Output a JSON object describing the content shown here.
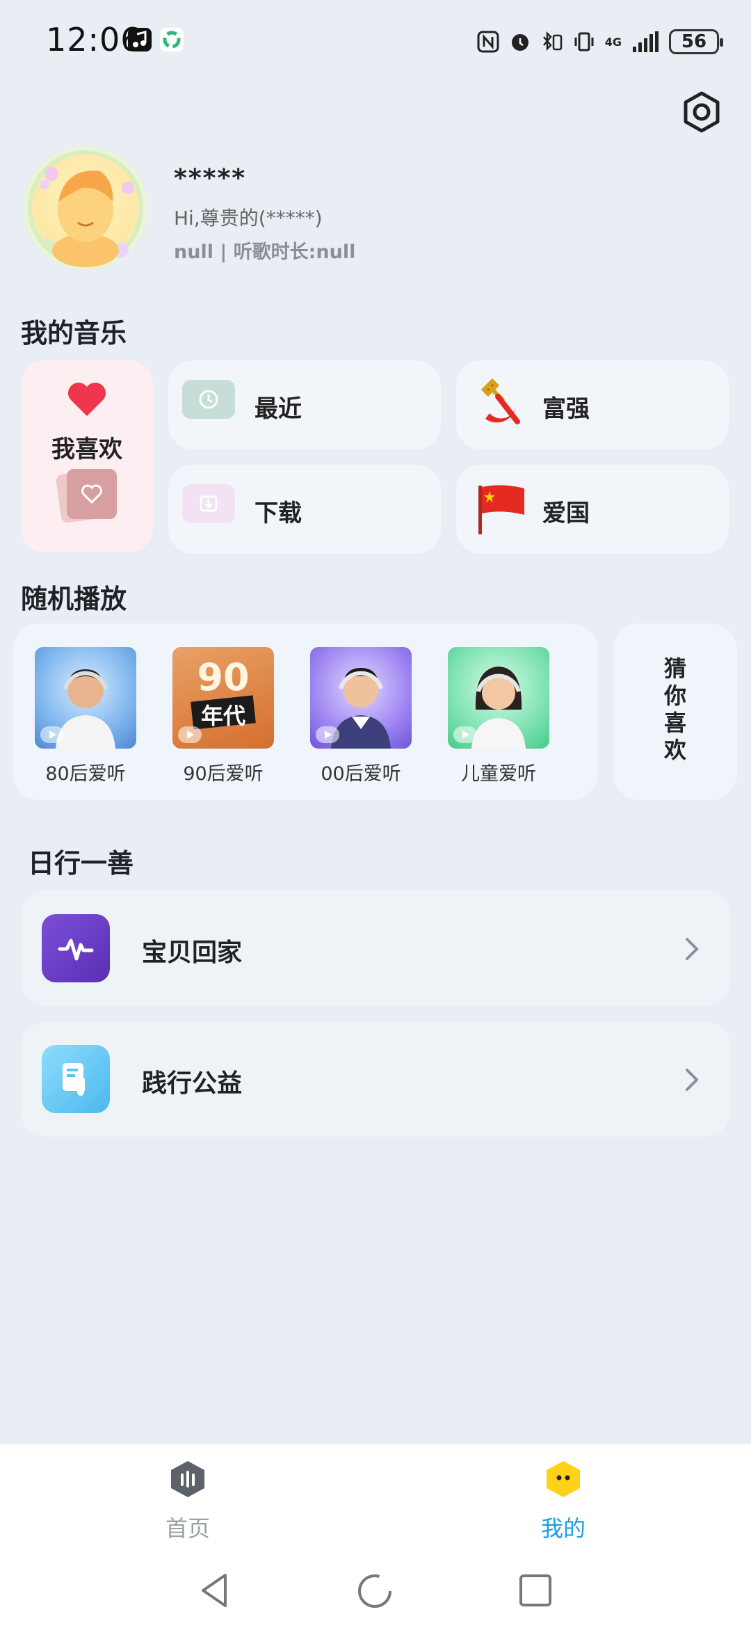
{
  "status_bar": {
    "time": "12:06",
    "battery": "56",
    "network": "4G"
  },
  "profile": {
    "username": "*****",
    "greeting": "Hi,尊贵的(*****)",
    "meta": "null | 听歌时长:null"
  },
  "my_music": {
    "title": "我的音乐",
    "like_label": "我喜欢",
    "recent_label": "最近",
    "download_label": "下载",
    "fuqiang_label": "富强",
    "aiguo_label": "爱国"
  },
  "random_play": {
    "title": "随机播放",
    "items": [
      {
        "label": "80后爱听"
      },
      {
        "label": "90后爱听"
      },
      {
        "label": "00后爱听"
      },
      {
        "label": "儿童爱听"
      }
    ],
    "cover_90_text_top": "90",
    "cover_90_text_bottom": "年代",
    "guess_label": "猜你喜欢"
  },
  "daily_good": {
    "title": "日行一善",
    "rows": [
      {
        "label": "宝贝回家"
      },
      {
        "label": "践行公益"
      }
    ]
  },
  "bottom_nav": {
    "home_label": "首页",
    "mine_label": "我的",
    "active_color": "#1a9ee0",
    "inactive_color": "#9aa0a6"
  },
  "colors": {
    "background": "#e8eef4",
    "heart": "#f0364c",
    "flag_red": "#e52a22",
    "accent_purple": "#6a3fc8",
    "accent_blue": "#5cc4f4"
  }
}
